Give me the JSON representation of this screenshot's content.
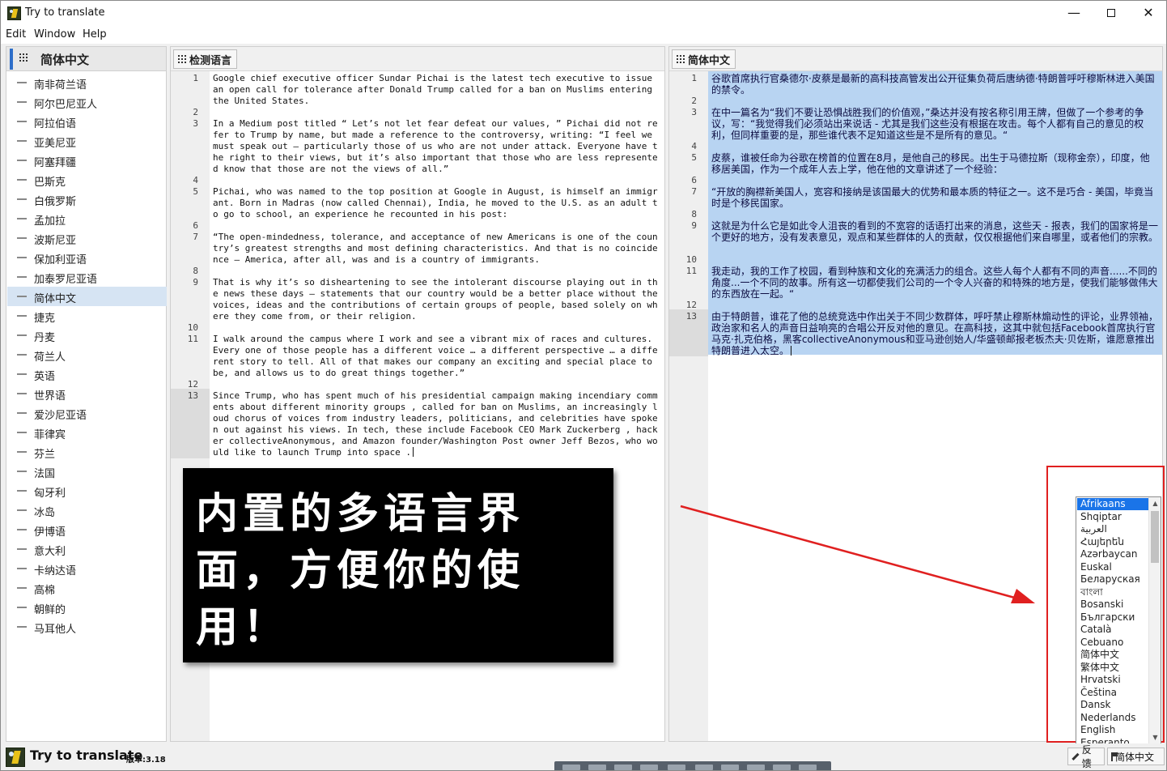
{
  "window": {
    "title": "Try to translate",
    "minimize": "—",
    "close": "✕"
  },
  "menu": [
    "Edit",
    "Window",
    "Help"
  ],
  "left_panel": {
    "header": "简体中文",
    "languages": [
      "南非荷兰语",
      "阿尔巴尼亚人",
      "阿拉伯语",
      "亚美尼亚",
      "阿塞拜疆",
      "巴斯克",
      "白俄罗斯",
      "孟加拉",
      "波斯尼亚",
      "保加利亚语",
      "加泰罗尼亚语",
      "简体中文",
      "捷克",
      "丹麦",
      "荷兰人",
      "英语",
      "世界语",
      "爱沙尼亚语",
      "菲律宾",
      "芬兰",
      "法国",
      "匈牙利",
      "冰岛",
      "伊博语",
      "意大利",
      "卡纳达语",
      "高棉",
      "朝鲜的",
      "马耳他人"
    ],
    "selected_index": 11
  },
  "source_editor": {
    "tab_label": "检测语言",
    "line_numbers": [
      "1",
      "2",
      "3",
      "4",
      "5",
      "6",
      "7",
      "8",
      "9",
      "10",
      "11",
      "12",
      "13"
    ],
    "current_line": "13",
    "paragraphs": [
      "Google chief executive officer Sundar Pichai is the latest tech executive to issue an open call for tolerance after Donald Trump called for a ban on Muslims entering the United States.",
      "In a Medium post titled “ Let’s not let fear defeat our values, ” Pichai did not refer to Trump by name, but made a reference to the controversy, writing: “I feel we must speak out — particularly those of us who are not under attack. Everyone have the right to their views, but it’s also important that those who are less represented know that those are not the views of all.”",
      "Pichai, who was named to the top position at Google in August, is himself an immigrant. Born in Madras (now called Chennai), India, he moved to the U.S. as an adult to go to school, an experience he recounted in his post:",
      "“The open-mindedness, tolerance, and acceptance of new Americans is one of the country’s greatest strengths and most defining characteristics. And that is no coincidence — America, after all, was and is a country of immigrants.",
      "That is why it’s so disheartening to see the intolerant discourse playing out in the news these days — statements that our country would be a better place without the voices, ideas and the contributions of certain groups of people, based solely on where they come from, or their religion.",
      "I walk around the campus where I work and see a vibrant mix of races and cultures. Every one of those people has a different voice … a different perspective … a different story to tell. All of that makes our company an exciting and special place to be, and allows us to do great things together.”",
      "Since Trump, who has spent much of his presidential campaign making incendiary comments about different minority groups , called for ban on Muslims, an increasingly loud chorus of voices from industry leaders, politicians, and celebrities have spoken out against his views. In tech, these include Facebook CEO Mark Zuckerberg , hacker collectiveAnonymous, and Amazon founder/Washington Post owner Jeff Bezos, who would like to launch Trump into space ."
    ]
  },
  "target_editor": {
    "tab_label": "简体中文",
    "line_numbers": [
      "1",
      "2",
      "3",
      "4",
      "5",
      "6",
      "7",
      "8",
      "9",
      "10",
      "11",
      "12",
      "13"
    ],
    "current_line": "13",
    "paragraphs": [
      "谷歌首席执行官桑德尔·皮蔡是最新的高科技高管发出公开征集负荷后唐纳德·特朗普呼吁穆斯林进入美国的禁令。",
      "在中一篇名为“我们不要让恐惧战胜我们的价值观，”桑达并没有按名称引用王牌，但做了一个参考的争议，写：“我觉得我们必须站出来说话 - 尤其是我们这些没有根据在攻击。每个人都有自己的意见的权利，但同样重要的是，那些谁代表不足知道这些是不是所有的意见。“",
      "皮蔡，谁被任命为谷歌在榜首的位置在8月，是他自己的移民。出生于马德拉斯（现称金奈），印度，他移居美国，作为一个成年人去上学，他在他的文章讲述了一个经验：",
      "“开放的胸襟新美国人，宽容和接纳是该国最大的优势和最本质的特征之一。这不是巧合 - 美国，毕竟当时是个移民国家。",
      "这就是为什么它是如此令人沮丧的看到的不宽容的话语打出来的消息，这些天 - 报表，我们的国家将是一个更好的地方，没有发表意见，观点和某些群体的人的贡献，仅仅根据他们来自哪里，或者他们的宗教。",
      "我走动，我的工作了校园，看到种族和文化的充满活力的组合。这些人每个人都有不同的声音......不同的角度...一个不同的故事。所有这一切都使我们公司的一个令人兴奋的和特殊的地方是，使我们能够做伟大的东西放在一起。“",
      "由于特朗普，谁花了他的总统竞选中作出关于不同少数群体，呼吁禁止穆斯林煽动性的评论，业界领袖，政治家和名人的声音日益响亮的合唱公开反对他的意见。在高科技，这其中就包括Facebook首席执行官马克·扎克伯格，黑客collectiveAnonymous和亚马逊创始人/华盛顿邮报老板杰夫·贝佐斯，谁愿意推出特朗普进入太空。"
    ]
  },
  "banner": {
    "lines": [
      "内置的多语言界",
      "面，方便你的使",
      "用！"
    ]
  },
  "ui_language_list": {
    "items": [
      "Afrikaans",
      "Shqiptar",
      "العربية",
      "Հայերեն",
      "Azərbaycan",
      "Euskal",
      "Беларуская",
      "বাংলা",
      "Bosanski",
      "Български",
      "Català",
      "Cebuano",
      "简体中文",
      "繁体中文",
      "Hrvatski",
      "Čeština",
      "Dansk",
      "Nederlands",
      "English",
      "Esperanto"
    ],
    "highlighted_index": 0
  },
  "status_bar": {
    "app_name": "Try to translate",
    "version": "版本:3.18",
    "feedback_label": "反馈",
    "language_label": "简体中文"
  },
  "colors": {
    "selection_blue": "#b8d4f2",
    "selected_language_row": "#d6e4f3",
    "list_highlight": "#1a74e8",
    "annotation_red": "#e02020"
  }
}
